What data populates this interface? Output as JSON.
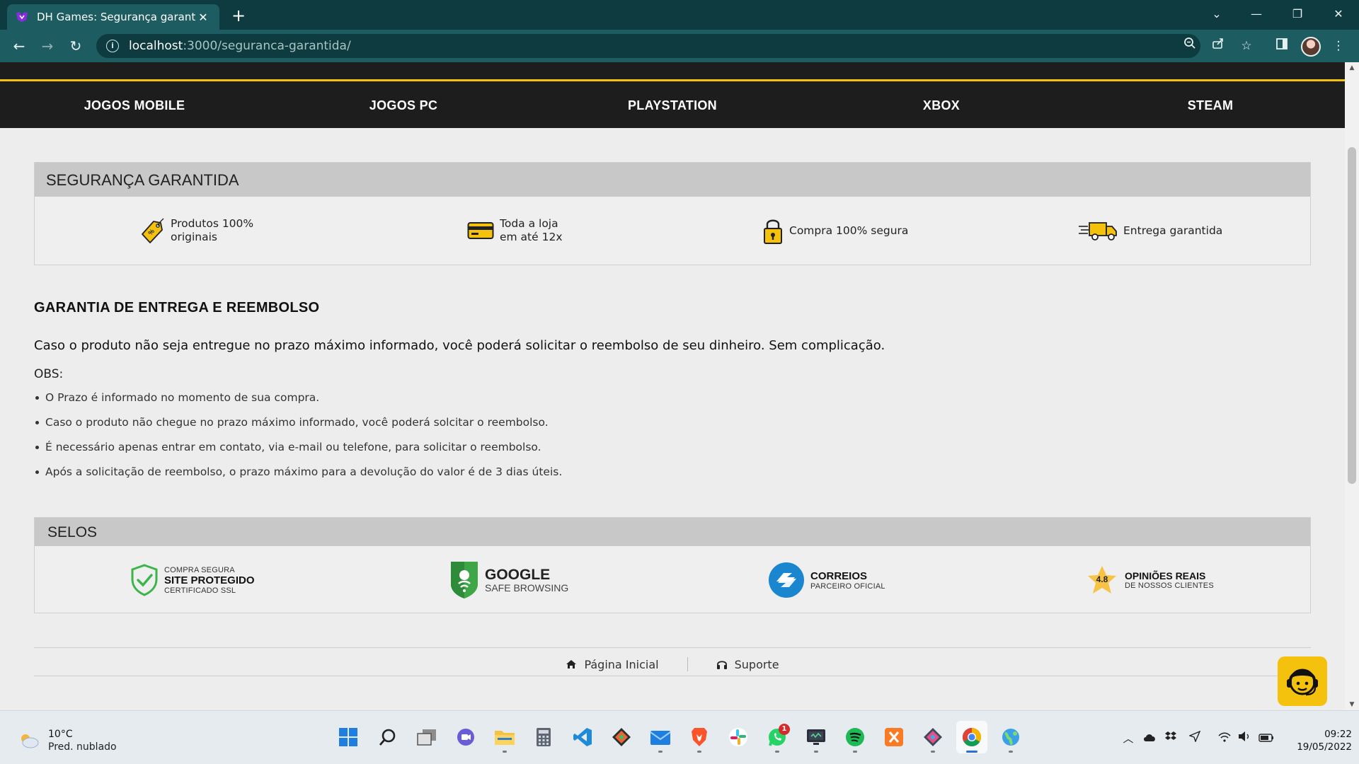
{
  "browser": {
    "tab_title": "DH Games: Segurança garantida",
    "url_host": "localhost",
    "url_path": ":3000/seguranca-garantida/"
  },
  "nav": {
    "items": [
      "JOGOS MOBILE",
      "JOGOS PC",
      "PLAYSTATION",
      "XBOX",
      "STEAM"
    ]
  },
  "security": {
    "title": "SEGURANÇA GARANTIDA",
    "features": [
      {
        "line1": "Produtos 100%",
        "line2": "originais",
        "icon": "tag-icon"
      },
      {
        "line1": "Toda a loja",
        "line2": "em até 12x",
        "icon": "credit-card-icon"
      },
      {
        "line1": "Compra 100% segura",
        "line2": "",
        "icon": "padlock-icon"
      },
      {
        "line1": "Entrega garantida",
        "line2": "",
        "icon": "delivery-truck-icon"
      }
    ]
  },
  "guarantee": {
    "title": "GARANTIA DE ENTREGA E REEMBOLSO",
    "lead": "Caso o produto não seja entregue no prazo máximo informado, você poderá solicitar o reembolso de seu dinheiro. Sem complicação.",
    "obs_label": "OBS:",
    "items": [
      "O Prazo é informado no momento de sua compra.",
      "Caso o produto não chegue no prazo máximo informado, você poderá solcitar o reembolso.",
      "É necessário apenas entrar em contato, via e-mail ou telefone, para solicitar o reembolso.",
      "Após a solicitação de reembolso, o prazo máximo para a devolução do valor é de 3 dias úteis."
    ]
  },
  "seals": {
    "title": "SELOS",
    "site_protegido": {
      "top": "COMPRA SEGURA",
      "main": "SITE PROTEGIDO",
      "bottom": "CERTIFICADO SSL"
    },
    "google": {
      "main": "GOOGLE",
      "sub": "SAFE BROWSING"
    },
    "correios": {
      "main": "CORREIOS",
      "sub": "PARCEIRO OFICIAL"
    },
    "opinioes": {
      "rating": "4.8",
      "main": "OPINIÕES REAIS",
      "sub": "DE NOSSOS CLIENTES"
    }
  },
  "footer": {
    "home_label": "Página Inicial",
    "support_label": "Suporte"
  },
  "taskbar": {
    "weather_temp": "10°C",
    "weather_desc": "Pred. nublado",
    "whatsapp_badge": "1",
    "time": "09:22",
    "date": "19/05/2022"
  },
  "colors": {
    "accent_yellow": "#f4c20d",
    "nav_bg": "#1d1d1d",
    "chrome_dark": "#0d3b3f",
    "chrome_toolbar": "#1d5c61"
  }
}
